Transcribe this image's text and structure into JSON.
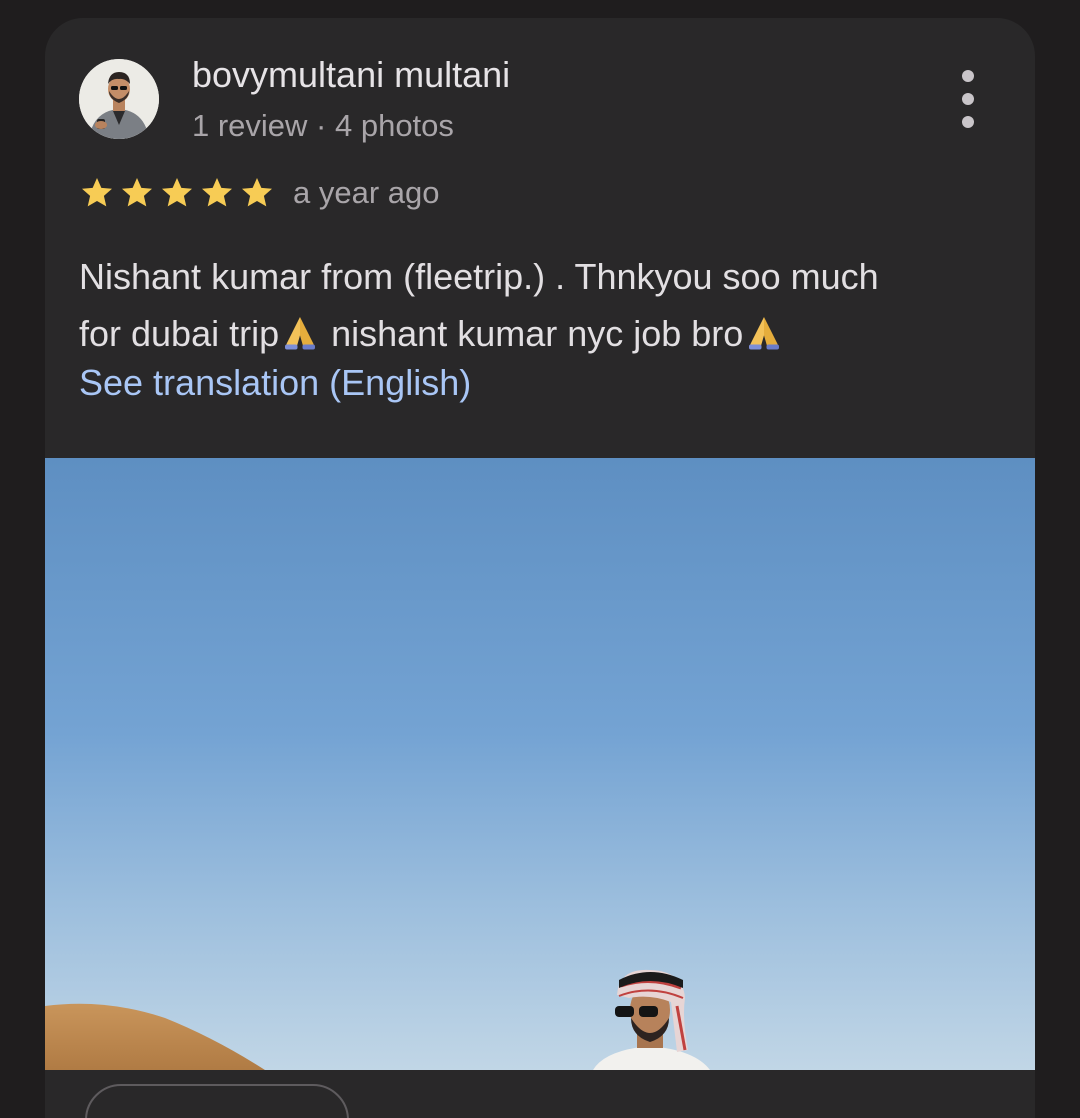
{
  "review": {
    "author_name": "bovymultani multani",
    "author_meta": "1 review · 4 photos",
    "rating": 5,
    "rating_max": 5,
    "time_ago": "a year ago",
    "text_line1": "Nishant kumar from (fleetrip.) . Thnkyou soo much",
    "text_line2a": "for dubai trip",
    "text_line2b": " nishant kumar nyc job bro",
    "translate_label": "See translation (English)"
  },
  "icons": {
    "more": "more-vert-icon",
    "star": "star-icon",
    "emoji": "folded-hands-emoji"
  },
  "colors": {
    "background": "#1f1d1e",
    "card": "#292829",
    "star": "#f7cc55",
    "link": "#a9c6f5",
    "primary_text": "#e6e3e6",
    "secondary_text": "#a9a5a9"
  }
}
